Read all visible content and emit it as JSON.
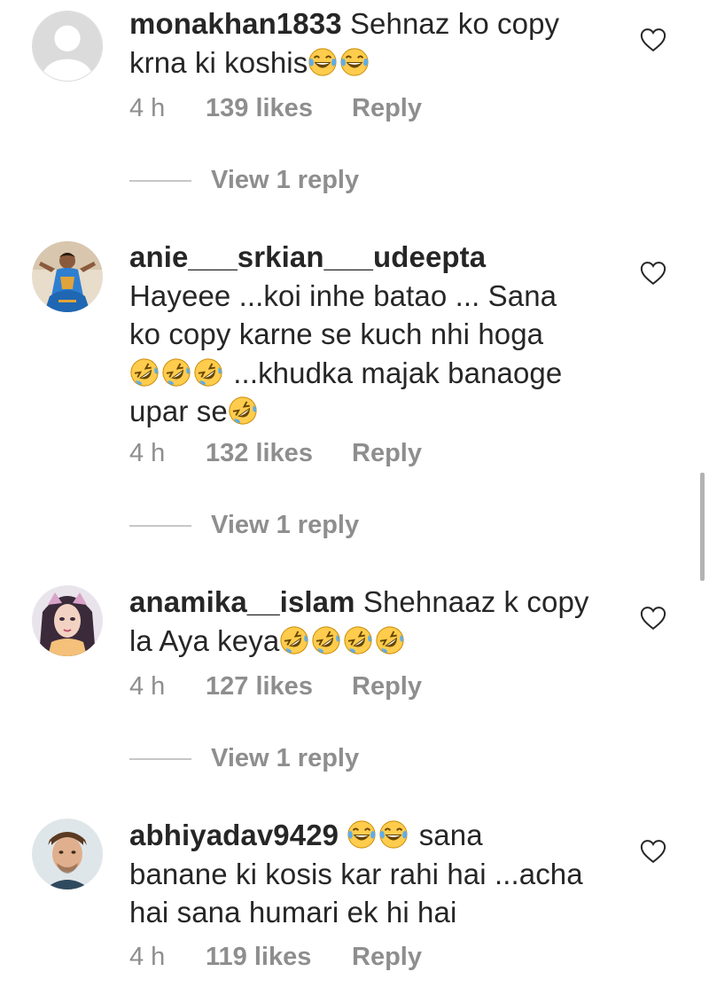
{
  "comments": [
    {
      "username": "monakhan1833",
      "text_lines": [
        "Sehnaz ko copy",
        "krna ki koshis"
      ],
      "emoji": [
        "grinning-tears-emoji",
        "grinning-tears-emoji"
      ],
      "time": "4 h",
      "likes": "139 likes",
      "reply": "Reply",
      "view_replies": "View 1 reply",
      "avatar": "default-avatar"
    },
    {
      "username": "anie___srkian___udeepta",
      "text_lines": [
        "Hayeee ...koi inhe batao ... Sana",
        "ko copy karne se kuch nhi hoga",
        "...khudka majak banaoge",
        "upar se"
      ],
      "emoji": [
        "rofl-emoji",
        "rofl-emoji",
        "rofl-emoji",
        "rofl-emoji"
      ],
      "time": "4 h",
      "likes": "132 likes",
      "reply": "Reply",
      "view_replies": "View 1 reply",
      "avatar": "dancer-avatar"
    },
    {
      "username": "anamika__islam",
      "text_lines": [
        "Shehnaaz k copy",
        "la Aya keya"
      ],
      "emoji": [
        "rofl-emoji",
        "rofl-emoji",
        "rofl-emoji",
        "rofl-emoji"
      ],
      "time": "4 h",
      "likes": "127 likes",
      "reply": "Reply",
      "view_replies": "View 1 reply",
      "avatar": "girl-avatar"
    },
    {
      "username": "abhiyadav9429",
      "text_lines": [
        "sana",
        "banane ki kosis kar rahi hai ...acha",
        "hai sana humari ek hi hai"
      ],
      "emoji": [
        "grinning-tears-emoji",
        "grinning-tears-emoji"
      ],
      "time": "4 h",
      "likes": "119 likes",
      "reply": "Reply",
      "avatar": "man-avatar"
    }
  ],
  "colors": {
    "text": "#262626",
    "meta": "#8e8e8e",
    "divider": "#c7c7c7",
    "emoji_face": "#ffcc4d",
    "emoji_tears": "#5dadec"
  }
}
